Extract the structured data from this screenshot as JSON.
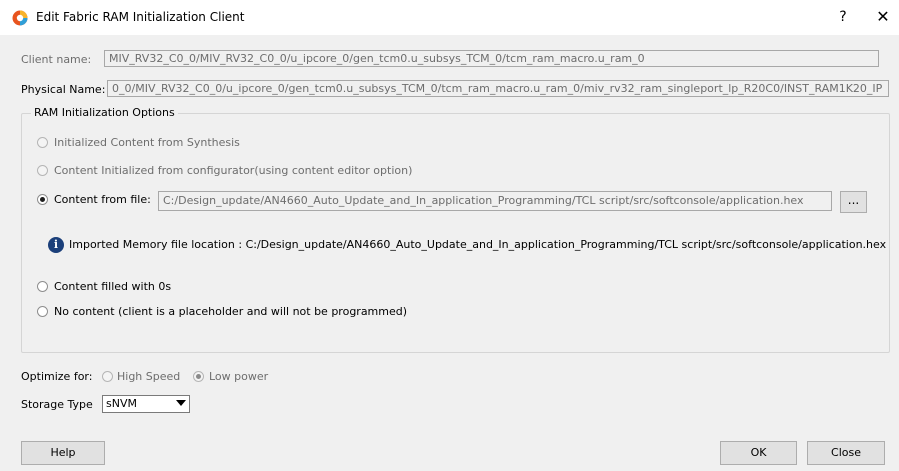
{
  "window": {
    "title": "Edit Fabric RAM Initialization Client",
    "help_glyph": "?",
    "close_glyph": "✕"
  },
  "client": {
    "name_label": "Client name:",
    "name_value": "MIV_RV32_C0_0/MIV_RV32_C0_0/u_ipcore_0/gen_tcm0.u_subsys_TCM_0/tcm_ram_macro.u_ram_0",
    "physical_label": "Physical Name:",
    "physical_value": "0_0/MIV_RV32_C0_0/u_ipcore_0/gen_tcm0.u_subsys_TCM_0/tcm_ram_macro.u_ram_0/miv_rv32_ram_singleport_lp_R20C0/INST_RAM1K20_IP"
  },
  "ram_options": {
    "legend": "RAM Initialization Options",
    "opt_synthesis": "Initialized Content from Synthesis",
    "opt_configurator": "Content Initialized from configurator(using content editor option)",
    "opt_file": "Content from file:",
    "file_path": "C:/Design_update/AN4660_Auto_Update_and_In_application_Programming/TCL script/src/softconsole/application.hex",
    "browse_label": "...",
    "info_text": "Imported Memory file location : C:/Design_update/AN4660_Auto_Update_and_In_application_Programming/TCL script/src/softconsole/application.hex",
    "opt_zeros": "Content filled with 0s",
    "opt_none": "No content (client is a placeholder and will not be programmed)",
    "selected": "Content from file:"
  },
  "optimize": {
    "label": "Optimize for:",
    "high_speed": "High Speed",
    "low_power": "Low power",
    "selected": "Low power"
  },
  "storage": {
    "label": "Storage Type",
    "value": "sNVM"
  },
  "buttons": {
    "help": "Help",
    "ok": "OK",
    "close": "Close"
  },
  "icons": {
    "app": "libero-app-icon",
    "info": "info-icon"
  },
  "colors": {
    "dialog_bg": "#f0f0f0",
    "titlebar_bg": "#ffffff",
    "info_icon": "#1b3f7a",
    "disabled_text": "#6d6d6d"
  }
}
